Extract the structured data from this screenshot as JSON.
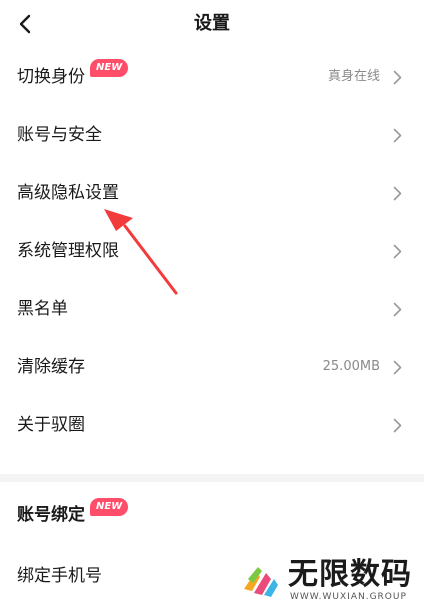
{
  "header": {
    "title": "设置"
  },
  "settings": [
    {
      "label": "切换身份",
      "badge": "NEW",
      "value": "真身在线"
    },
    {
      "label": "账号与安全"
    },
    {
      "label": "高级隐私设置"
    },
    {
      "label": "系统管理权限"
    },
    {
      "label": "黑名单"
    },
    {
      "label": "清除缓存",
      "value": "25.00MB"
    },
    {
      "label": "关于驭圈"
    }
  ],
  "binding": {
    "title": "账号绑定",
    "badge": "NEW",
    "items": [
      {
        "label": "绑定手机号"
      }
    ]
  },
  "watermark": {
    "brand": "无限数码",
    "url": "WWW.WUXIAN.GROUP"
  },
  "colors": {
    "accent": "#ff4d6a",
    "arrow": "#f23c3c",
    "chevron": "#9a9a9a",
    "background": "#f4f4f4"
  }
}
